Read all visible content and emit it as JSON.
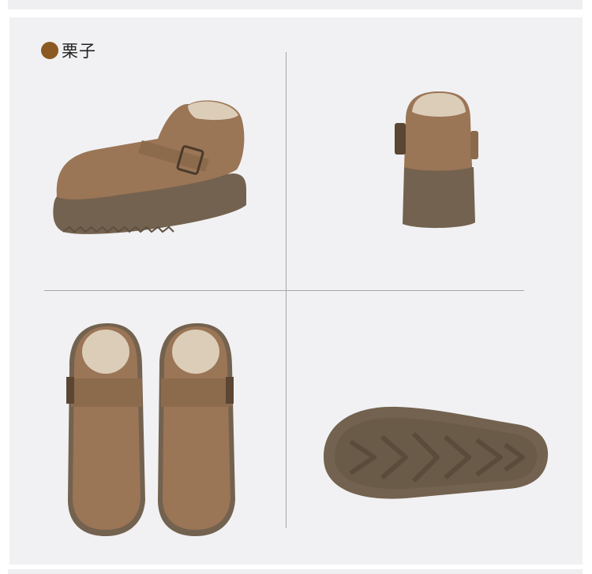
{
  "color_option": {
    "swatch_color": "#8b5a22",
    "name": "栗子"
  },
  "images": [
    {
      "view": "side-angle",
      "icon": "shoe-side-view-photo"
    },
    {
      "view": "back",
      "icon": "shoe-back-view-photo"
    },
    {
      "view": "top-pair",
      "icon": "shoe-pair-top-view-photo"
    },
    {
      "view": "sole",
      "icon": "shoe-sole-view-photo"
    }
  ],
  "colors": {
    "suede": "#9a7556",
    "sole": "#73624f",
    "fur": "#dccdb8"
  }
}
